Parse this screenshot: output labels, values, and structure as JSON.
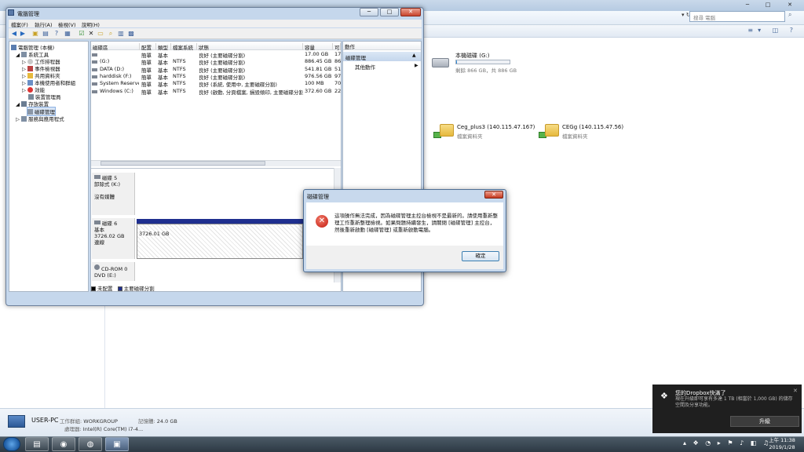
{
  "explorer": {
    "search_placeholder": "搜尋 電腦",
    "drive": {
      "name": "本機磁碟 (G:)",
      "free_text": "剩餘 866 GB，共 886 GB",
      "used_fraction": 0.02
    },
    "shares": [
      {
        "name": "Ceg_plus3 (140.115.47.167)",
        "sub": "檔案資料夾"
      },
      {
        "name": "CEGg (140.115.47.56)",
        "sub": "檔案資料夾"
      }
    ],
    "details": {
      "pc_name": "USER-PC",
      "workgroup_label": "工作群組:",
      "workgroup": "WORKGROUP",
      "memory_label": "記憶體:",
      "memory": "24.0 GB",
      "processor_label": "處理器:",
      "processor": "Intel(R) Core(TM) i7-4..."
    }
  },
  "computer_management": {
    "title": "電腦管理",
    "menu": [
      "檔案(F)",
      "執行(A)",
      "檢視(V)",
      "說明(H)"
    ],
    "tree": [
      "電腦管理 (本機)",
      "系統工具",
      "工作排程器",
      "事件檢視器",
      "共用資料夾",
      "本機使用者和群組",
      "效能",
      "裝置管理員",
      "存放裝置",
      "磁碟管理",
      "服務與應用程式"
    ],
    "columns": [
      "磁碟區",
      "配置",
      "類型",
      "檔案系統",
      "狀態",
      "容量",
      "可"
    ],
    "volumes": [
      [
        "",
        "簡單",
        "基本",
        "",
        "良好 (主要磁碟分割)",
        "17.00 GB",
        "17"
      ],
      [
        "(G:)",
        "簡單",
        "基本",
        "NTFS",
        "良好 (主要磁碟分割)",
        "886.45 GB",
        "86"
      ],
      [
        "DATA (D:)",
        "簡單",
        "基本",
        "NTFS",
        "良好 (主要磁碟分割)",
        "541.81 GB",
        "51"
      ],
      [
        "harddisk (F:)",
        "簡單",
        "基本",
        "NTFS",
        "良好 (主要磁碟分割)",
        "976.56 GB",
        "97"
      ],
      [
        "System Reserved",
        "簡單",
        "基本",
        "NTFS",
        "良好 (系統, 使用中, 主要磁碟分割)",
        "100 MB",
        "70"
      ],
      [
        "Windows (C:)",
        "簡單",
        "基本",
        "NTFS",
        "良好 (啟動, 分頁檔案, 損毀傾印, 主要磁碟分割)",
        "372.60 GB",
        "22"
      ]
    ],
    "disks": [
      {
        "name": "磁碟 5",
        "lines": [
          "卸除式 (K:)",
          "",
          "沒有媒體"
        ]
      },
      {
        "name": "磁碟 6",
        "lines": [
          "基本",
          "3726.02 GB",
          "連線"
        ],
        "partition": "3726.01 GB"
      },
      {
        "name": "CD-ROM 0",
        "lines": [
          "DVD (E:)"
        ]
      }
    ],
    "legend": [
      "未配置",
      "主要磁碟分割"
    ],
    "actions": {
      "header": "動作",
      "section": "磁碟管理",
      "item": "其他動作"
    }
  },
  "dialog": {
    "title": "磁碟管理",
    "close": "✕",
    "message": "這項操作無法完成，因為磁碟管理主控台檢視不是最新的。請使用重新整理工作重新整理檢視。如果問題持續發生，請關閉 [磁碟管理] 主控台，然後重新啟動 [磁碟管理] 或重新啟動電腦。",
    "ok": "確定"
  },
  "toast": {
    "title": "您的Dropbox快滿了",
    "body": "現在升級即可享有多達 1 TB (相當於 1,000 GB) 的儲存空間及分享功能。",
    "button": "升級",
    "close": "✕"
  },
  "taskbar": {
    "time": "上午 11:38",
    "date": "2019/1/28"
  },
  "colors": {
    "primary_partition": "#1f2f8f",
    "error_icon": "#c41a0e",
    "toast_bg": "#1f1f1f"
  }
}
